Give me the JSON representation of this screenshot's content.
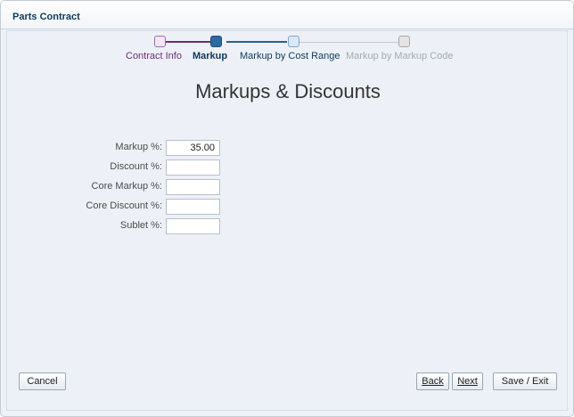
{
  "window": {
    "title": "Parts Contract"
  },
  "train": {
    "steps": [
      {
        "label": "Contract Info",
        "state": "visited"
      },
      {
        "label": "Markup",
        "state": "current"
      },
      {
        "label": "Markup by Cost Range",
        "state": "next"
      },
      {
        "label": "Markup by Markup Code",
        "state": "disabled"
      }
    ],
    "colors": {
      "visited": "#6b2d7f",
      "current": "#2d6a9e",
      "next": "#d9e8f7",
      "disabled": "#a3a9b1"
    }
  },
  "page": {
    "title": "Markups & Discounts"
  },
  "form": {
    "fields": [
      {
        "label": "Markup %:",
        "value": "35.00"
      },
      {
        "label": "Discount %:",
        "value": ""
      },
      {
        "label": "Core Markup %:",
        "value": ""
      },
      {
        "label": "Core Discount %:",
        "value": ""
      },
      {
        "label": "Sublet %:",
        "value": ""
      }
    ]
  },
  "buttons": {
    "cancel": "Cancel",
    "back": "Back",
    "next": "Next",
    "save_exit": "Save / Exit"
  }
}
